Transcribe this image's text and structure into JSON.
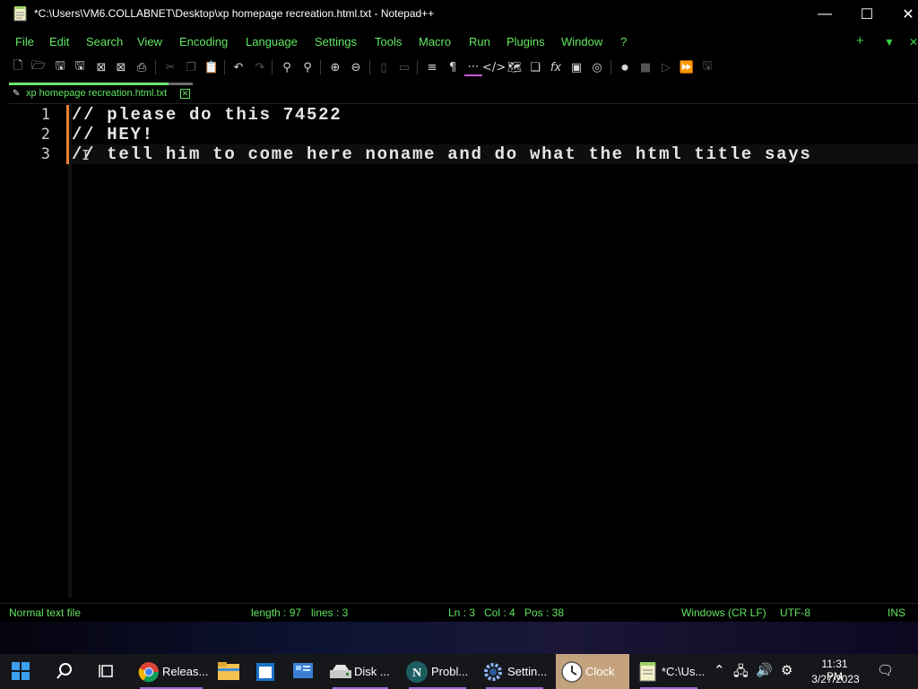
{
  "window": {
    "title": "*C:\\Users\\VM6.COLLABNET\\Desktop\\xp homepage recreation.html.txt - Notepad++",
    "minimize_glyph": "—",
    "maximize_glyph": "☐",
    "close_glyph": "✕"
  },
  "menu": {
    "items": [
      "File",
      "Edit",
      "Search",
      "View",
      "Encoding",
      "Language",
      "Settings",
      "Tools",
      "Macro",
      "Run",
      "Plugins",
      "Window",
      "?"
    ],
    "plus_glyph": "+",
    "down_glyph": "▼",
    "close_glyph": "✕"
  },
  "toolbar": {
    "icons": [
      "new-file-icon",
      "open-file-icon",
      "save-icon",
      "save-all-icon",
      "close-icon",
      "close-all-icon",
      "print-icon",
      "cut-icon",
      "copy-icon",
      "paste-icon",
      "undo-icon",
      "redo-icon",
      "find-icon",
      "replace-icon",
      "zoom-in-icon",
      "zoom-out-icon",
      "sync-vertical-icon",
      "sync-horizontal-icon",
      "word-wrap-icon",
      "show-all-chars-icon",
      "indent-guide-icon",
      "xml-tag-icon",
      "document-map-icon",
      "document-list-icon",
      "function-list-icon",
      "folder-as-workspace-icon",
      "monitoring-icon",
      "record-macro-icon",
      "stop-recording-icon",
      "play-macro-icon",
      "run-macro-multiple-icon",
      "save-macro-icon"
    ]
  },
  "tab": {
    "label": "xp homepage recreation.html.txt",
    "close_glyph": "✕",
    "accent_color": "#6de56d"
  },
  "editor": {
    "lines": [
      {
        "number": "1",
        "text": "// please do this 74522"
      },
      {
        "number": "2",
        "text": "// HEY!"
      },
      {
        "number": "3",
        "text": "// tell him to come here noname and do what the html title says"
      }
    ],
    "current_line": 3,
    "change_marker_color": "#f08030"
  },
  "status": {
    "file_type": "Normal text file",
    "length": "length : 97",
    "lines": "lines : 3",
    "ln": "Ln : 3",
    "col": "Col : 4",
    "pos": "Pos : 38",
    "eol": "Windows (CR LF)",
    "encoding": "UTF-8",
    "mode": "INS"
  },
  "taskbar": {
    "apps": [
      {
        "label": "Releas...",
        "icon": "chrome-icon"
      },
      {
        "label": "",
        "icon": "file-explorer-icon"
      },
      {
        "label": "",
        "icon": "notepad-icon"
      },
      {
        "label": "",
        "icon": "control-panel-icon"
      },
      {
        "label": "Disk ...",
        "icon": "disk-icon"
      },
      {
        "label": "Probl...",
        "icon": "app-n-icon"
      },
      {
        "label": "Settin...",
        "icon": "settings-icon"
      },
      {
        "label": "Clock",
        "icon": "clock-app-icon"
      },
      {
        "label": "*C:\\Us...",
        "icon": "notepadpp-icon"
      }
    ],
    "time": "11:31 PM",
    "date": "3/27/2023"
  }
}
